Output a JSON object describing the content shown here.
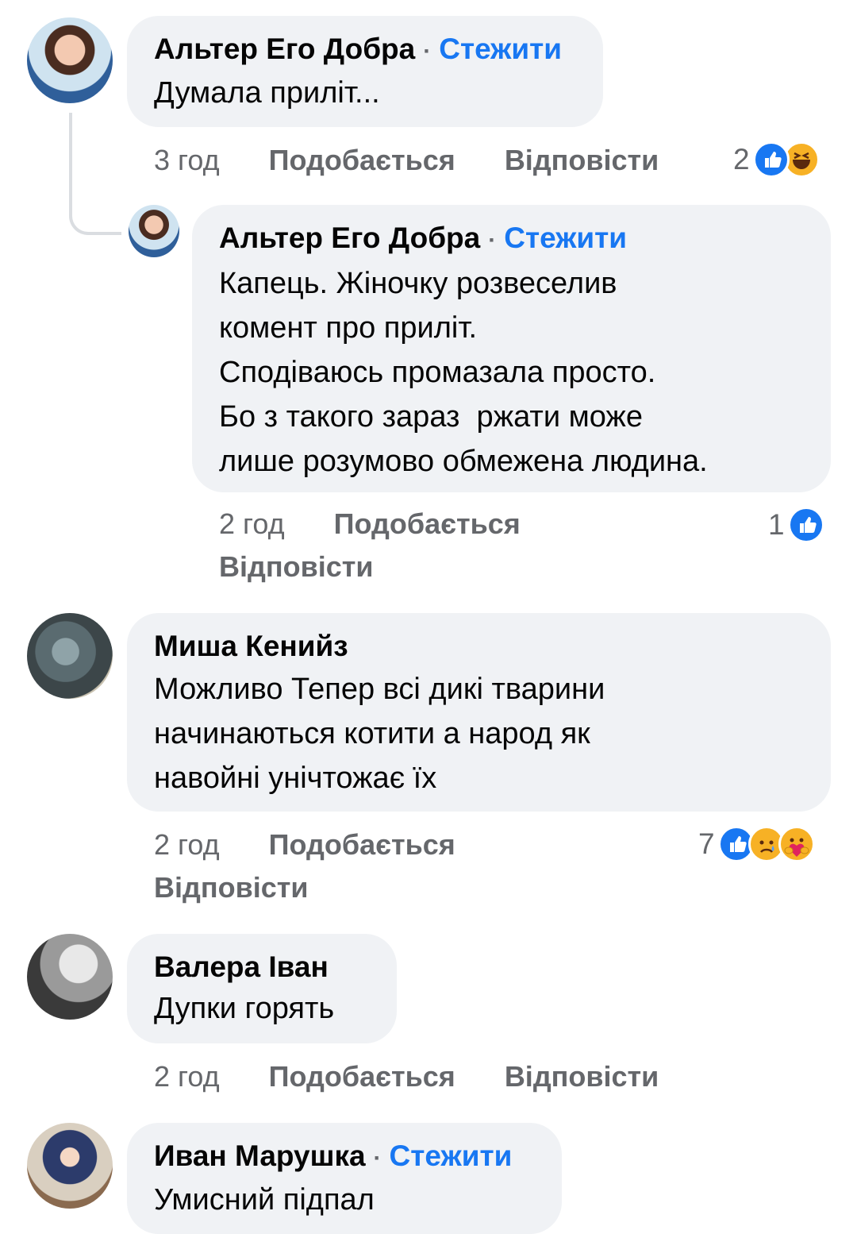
{
  "follow_label": "Стежити",
  "comments": [
    {
      "author": "Альтер Его Добра",
      "text": [
        "Думала приліт..."
      ],
      "time": "3 год",
      "like_label": "Подобається",
      "reply_label": "Відповісти",
      "reaction_count": "2",
      "reactions": [
        "like-icon",
        "haha-icon"
      ]
    },
    {
      "author": "Альтер Его Добра",
      "text": [
        "Капець. Жіночку розвеселив",
        "комент про приліт.",
        "Сподіваюсь промазала просто.",
        "Бо з такого зараз  ржати може",
        "лише розумово обмежена людина."
      ],
      "time": "2 год",
      "like_label": "Подобається",
      "reply_label": "Відповісти",
      "reaction_count": "1",
      "reactions": [
        "like-icon"
      ]
    },
    {
      "author": "Миша Кенийз",
      "text": [
        "Можливо Тепер всі дикі тварини",
        "начинаються котити а народ як",
        "навойні унічтожає їх"
      ],
      "time": "2 год",
      "like_label": "Подобається",
      "reply_label": "Відповісти",
      "reaction_count": "7",
      "reactions": [
        "like-icon",
        "sad-icon",
        "care-icon"
      ]
    },
    {
      "author": "Валера Іван",
      "text": [
        "Дупки горять"
      ],
      "time": "2 год",
      "like_label": "Подобається",
      "reply_label": "Відповісти"
    },
    {
      "author": "Иван Марушка",
      "text": [
        "Умисний підпал"
      ]
    }
  ],
  "colors": {
    "bubble": "#f0f2f5",
    "follow": "#1877f2",
    "meta": "#65676b",
    "like": "#1877f2",
    "emoji": "#f7b125"
  }
}
